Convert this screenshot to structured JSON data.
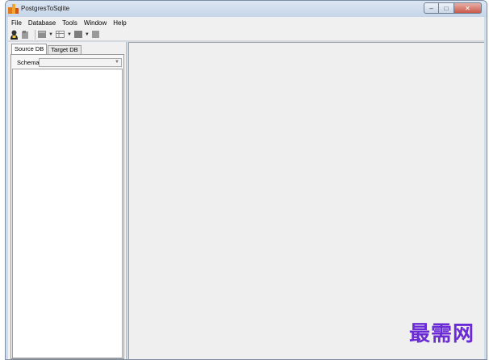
{
  "window": {
    "title": "PostgresToSqlite",
    "buttons": {
      "minimize": "–",
      "maximize": "□",
      "close": "✕"
    }
  },
  "menubar": {
    "items": [
      "File",
      "Database",
      "Tools",
      "Window",
      "Help"
    ]
  },
  "toolbar": {
    "icons": [
      "connect-user-icon",
      "edit-icon",
      "database-icon",
      "table-icon",
      "grid-icon",
      "stop-icon"
    ]
  },
  "left_panel": {
    "tabs": [
      "Source DB",
      "Target DB"
    ],
    "active_tab": "Source DB",
    "schema_label": "Schema",
    "schema_value": ""
  },
  "watermark": {
    "text": "最需网"
  },
  "colors": {
    "watermark": "#6a2bd6",
    "titlebar": "#cfdceb",
    "workspace": "#efefef"
  }
}
